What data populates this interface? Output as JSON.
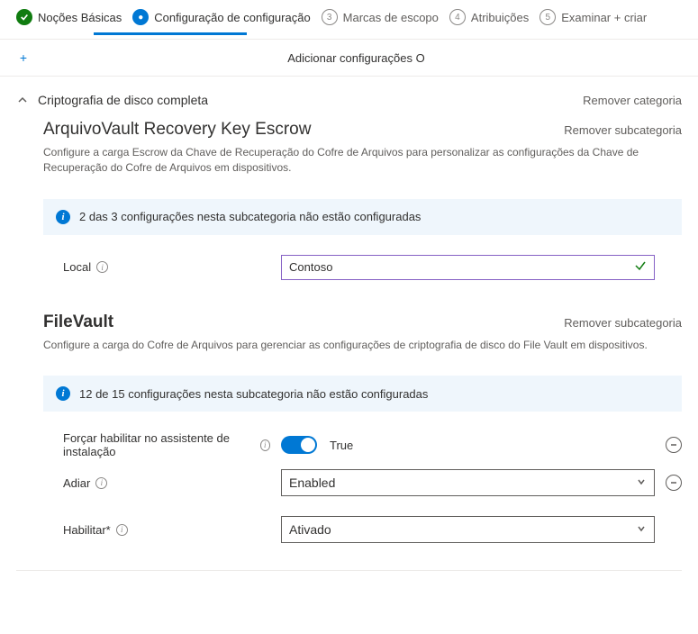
{
  "stepper": {
    "steps": [
      {
        "num": "✓",
        "label": "Noções Básicas",
        "state": "completed"
      },
      {
        "num": "2",
        "label": "Configuração de configuração",
        "state": "active"
      },
      {
        "num": "3",
        "label": "Marcas de escopo",
        "state": "pending"
      },
      {
        "num": "4",
        "label": "Atribuições",
        "state": "pending"
      },
      {
        "num": "5",
        "label": "Examinar + criar",
        "state": "pending"
      }
    ]
  },
  "addSettings": {
    "label": "Adicionar configurações O"
  },
  "category": {
    "title": "Criptografia de disco completa",
    "removeLabel": "Remover categoria"
  },
  "sub1": {
    "title": "ArquivoVault Recovery Key Escrow",
    "removeLabel": "Remover subcategoria",
    "desc": "Configure a carga Escrow da Chave de Recuperação do Cofre de Arquivos para personalizar as configurações da Chave de Recuperação do Cofre de Arquivos em dispositivos.",
    "banner": "2 das 3 configurações nesta subcategoria não estão configuradas",
    "setting_local": {
      "label": "Local",
      "value": "Contoso"
    }
  },
  "sub2": {
    "title": "FileVault",
    "removeLabel": "Remover subcategoria",
    "desc": "Configure a carga do Cofre de Arquivos para gerenciar as configurações de criptografia de disco do File Vault em dispositivos.",
    "banner": "12 de 15 configurações nesta subcategoria não estão configuradas",
    "force": {
      "label": "Forçar habilitar no assistente de instalação",
      "valueText": "True"
    },
    "adiar": {
      "label": "Adiar",
      "value": "Enabled"
    },
    "habilitar": {
      "label": "Habilitar*",
      "value": "Ativado"
    }
  }
}
